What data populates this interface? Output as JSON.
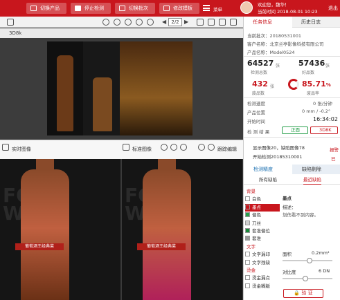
{
  "topbar": {
    "switch_product": "切换产品",
    "stop_detect": "停止检测",
    "switch_batch": "切换批次",
    "modify_template": "修改模板",
    "menu": "菜单",
    "welcome": "欢迎您，魏华！",
    "time_label": "当前时间",
    "time_value": "2018-08-01 10:23",
    "logout": "退出"
  },
  "viewer": {
    "page_indicator": "2/2",
    "pdf_name": "3D8k"
  },
  "panes": {
    "left_title": "实时图像",
    "right_title": "标准图像",
    "right_tool": "跟踪编辑",
    "brochure_title": "葡萄酒王经典菜",
    "fod_text": "FOOD\nWINE"
  },
  "right_panel": {
    "tabs": [
      "任务信息",
      "历史日志"
    ],
    "info": {
      "batch_label": "当前批次：",
      "batch_value": "20180531001",
      "client_label": "客户名称：",
      "client_value": "北京兰亭影像科技有限公司",
      "product_label": "产品名称：",
      "product_value": "Model0524"
    },
    "stats": {
      "detected_count": "64527",
      "detected_unit": "张",
      "detected_label": "检测总数",
      "good_count": "57436",
      "good_unit": "张",
      "good_label": "好品数",
      "bad_count": "432",
      "bad_unit": "张",
      "bad_label": "废品数",
      "rate_value": "85.71",
      "rate_unit": "%",
      "rate_label": "废品率"
    },
    "speed": {
      "speed_label": "检测速度",
      "speed_value": "0",
      "speed_unit": "张/分钟",
      "offset_label": "产品位置",
      "offset_value": "0",
      "offset_unit": "mm",
      "offset_angle": "-0.2",
      "offset_angle_unit": "°",
      "start_label": "开始时间",
      "start_value": "16:34:02",
      "result_label": "检  测  结  果",
      "ok_label": "正面",
      "err_label": "3D8K"
    },
    "events": [
      "显示图像20，缺陷图像78",
      "开始检测20185310001"
    ],
    "event_tag_1": "报警",
    "event_tag_2": "已",
    "defect_tabs": [
      "检测精度",
      "缺陷剔除"
    ],
    "defect_subtabs": [
      "所有缺陷",
      "最近缺陷"
    ],
    "categories": [
      {
        "name": "背景",
        "header": true
      },
      {
        "name": "白色",
        "color": "#ffffff"
      },
      {
        "name": "墨点",
        "color": "#c8161d",
        "selected": true
      },
      {
        "name": "偏色",
        "color": "#27a04b"
      },
      {
        "name": "刀丝",
        "color": "#d0d0d0"
      },
      {
        "name": "套准偏位",
        "color": "#1a8a3a"
      },
      {
        "name": "套准",
        "color": "#999999"
      },
      {
        "name": "文字",
        "header": true
      },
      {
        "name": "文字漏印",
        "color": "#ffffff"
      },
      {
        "name": "文字残缺",
        "color": "#ffffff"
      },
      {
        "name": "烫金",
        "header": true
      },
      {
        "name": "烫金漏点",
        "color": "#ffffff"
      },
      {
        "name": "烫金糊版",
        "color": "#ffffff"
      }
    ],
    "detail": {
      "name": "墨点",
      "desc_label": "描述：",
      "desc_value": "划伤看不到内容。",
      "area_label": "面积",
      "area_value": "0.2mm²",
      "area_level": 0.55,
      "contrast_label": "对比度",
      "contrast_value": "6 DN",
      "contrast_level": 0.45,
      "verify_label": "验  证"
    }
  }
}
